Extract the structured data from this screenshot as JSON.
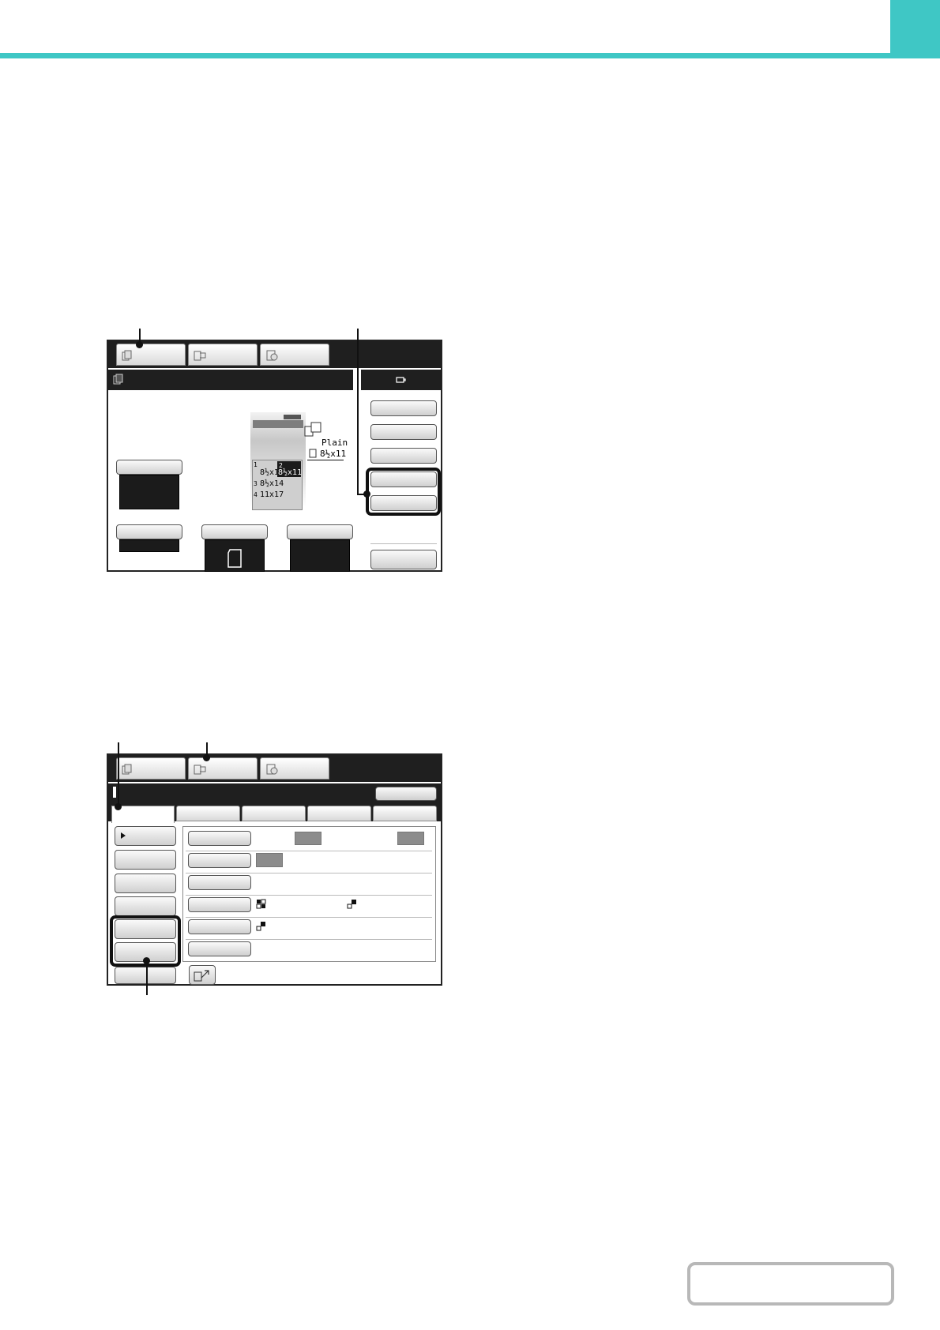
{
  "colors": {
    "accent": "#3fc7c5",
    "panel_dark": "#1f1f1f"
  },
  "screen1": {
    "machine": {
      "paper_type": "Plain",
      "paper_size": "8½x11",
      "trays": [
        {
          "num": "1",
          "size": "8½x11"
        },
        {
          "num": "2",
          "size": "8½x11"
        },
        {
          "num": "3",
          "size": "8½x14"
        },
        {
          "num": "4",
          "size": "11x17"
        }
      ]
    }
  },
  "screen2": {},
  "icons": [
    "copy-mode-icon",
    "image-send-mode-icon",
    "document-filing-mode-icon",
    "toner-icon",
    "cursor-arrow-icon"
  ]
}
